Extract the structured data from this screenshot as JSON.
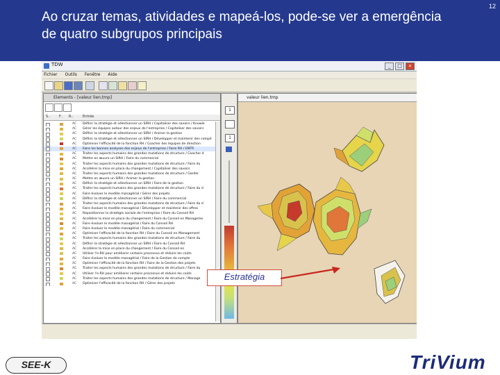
{
  "slide": {
    "title": "Ao cruzar temas, atividades e mapeá-los, pode-se ver a emergência\nde quatro subgrupos principais",
    "page_number": "12",
    "callout_label": "Estratégia",
    "logo_left": "SEE-K",
    "logo_right": "TriVium"
  },
  "app": {
    "title": "TDW",
    "menu": [
      "Fichier",
      "Outils",
      "Fenêtre",
      "Aide"
    ],
    "window_buttons": [
      "_",
      "□",
      "×"
    ]
  },
  "left_window": {
    "title": "Elements - [valeur lien.tmp]",
    "columns": [
      "S..",
      "F..",
      "R..",
      "Entrée"
    ],
    "rows": [
      {
        "color": "#d9a23a",
        "type": "AC",
        "label": "Définir la stratégie et sélectionner un SIRH / Capitaliser des savoirs / Knowle"
      },
      {
        "color": "#e0b53e",
        "type": "AC",
        "label": "Gérer les équipes autour des enjeux de l'entreprise / Capitaliser des savoirs"
      },
      {
        "color": "#e8c84a",
        "type": "AC",
        "label": "Définir la stratégie et sélectionner un SIRH / Animer la gestion"
      },
      {
        "color": "#cfd65a",
        "type": "AC",
        "label": "Définir la stratégie et sélectionner un SIRH / Développer et maintenir des compé"
      },
      {
        "color": "#c53a2b",
        "type": "AC",
        "label": "Optimiser l'efficacité de la fonction RH / Coacher des équipes de direction"
      },
      {
        "color": "#e2a236",
        "type": "AC",
        "label": "Faire les bonnes analyses des enjeux de l'entreprise / Faire RH / ENTR"
      },
      {
        "color": "#e6b73f",
        "type": "AC",
        "label": "Traiter les aspects humains des grandes mutations de structure / Coacher d"
      },
      {
        "color": "#d68b30",
        "type": "AC",
        "label": "Mettre en œuvre un SIRH / Faire du commercial"
      },
      {
        "color": "#e8c84a",
        "type": "AC",
        "label": "Traiter les aspects humains des grandes mutations de structure / Faire du"
      },
      {
        "color": "#e5a83a",
        "type": "AC",
        "label": "Accélérer la mise en place du changement / Capitaliser des savoirs"
      },
      {
        "color": "#e0bb44",
        "type": "AC",
        "label": "Traiter les aspects humains des grandes mutations de structure / Garder"
      },
      {
        "color": "#d9c24c",
        "type": "AC",
        "label": "Mettre en œuvre un SIRH / Animer la gestion"
      },
      {
        "color": "#e6b73f",
        "type": "AC",
        "label": "Définir la stratégie et sélectionner un SIRH / Faire de la gestion"
      },
      {
        "color": "#e0763a",
        "type": "AC",
        "label": "Traiter les aspects humains des grandes mutations de structure / Faire du d"
      },
      {
        "color": "#e8c84a",
        "type": "AC",
        "label": "Faire évoluer le modèle managérial / Gérer des projets"
      },
      {
        "color": "#c7d45e",
        "type": "AC",
        "label": "Définir la stratégie et sélectionner un SIRH / Faire du commercial"
      },
      {
        "color": "#d9a23a",
        "type": "AC",
        "label": "Traiter les aspects humains des grandes mutations de structure / Faire du d"
      },
      {
        "color": "#e5a83a",
        "type": "AC",
        "label": "Faire évoluer le modèle managérial / Développer et maintenir des offres"
      },
      {
        "color": "#e8c84a",
        "type": "AC",
        "label": "Repositionner la stratégie sociale de l'entreprise / Faire du Conseil RH"
      },
      {
        "color": "#e0bb44",
        "type": "AC",
        "label": "Accélérer la mise en place du changement / Faire du Conseil en Manageme"
      },
      {
        "color": "#d68b30",
        "type": "AC",
        "label": "Faire évoluer le modèle managérial / Faire du Conseil RH"
      },
      {
        "color": "#e6b73f",
        "type": "AC",
        "label": "Faire évoluer le modèle managérial / Faire du commercial"
      },
      {
        "color": "#e2a236",
        "type": "AC",
        "label": "Optimiser l'efficacité de la fonction RH / Faire du Conseil en Management"
      },
      {
        "color": "#cfd65a",
        "type": "AC",
        "label": "Traiter les aspects humains des grandes mutations de structure / Faire du"
      },
      {
        "color": "#e8c84a",
        "type": "AC",
        "label": "Définir la stratégie et sélectionner un SIRH / Faire du Conseil RH"
      },
      {
        "color": "#e0bb44",
        "type": "AC",
        "label": "Accélérer la mise en place du changement / Faire du Conseil en"
      },
      {
        "color": "#d9c24c",
        "type": "AC",
        "label": "Utiliser l'e-RH pour améliorer certains processus et réduire les coûts"
      },
      {
        "color": "#e5a83a",
        "type": "AC",
        "label": "Faire évoluer le modèle managérial / Faire de la Gestion de compte"
      },
      {
        "color": "#e6b73f",
        "type": "AC",
        "label": "Optimiser l'efficacité de la fonction RH / Faire de la Gestion des projets"
      },
      {
        "color": "#d68b30",
        "type": "AC",
        "label": "Traiter les aspects humains des grandes mutations de structure / Faire du"
      },
      {
        "color": "#e8c84a",
        "type": "AC",
        "label": "Utiliser l'e-RH pour améliorer certains processus et réduire les coûts"
      },
      {
        "color": "#cfd65a",
        "type": "AC",
        "label": "Traiter les aspects humains des grandes mutations de structure / Manage"
      },
      {
        "color": "#e2a236",
        "type": "AC",
        "label": "Optimiser l'efficacité de la fonction RH / Gérer des projets"
      }
    ]
  },
  "scale_panel": {
    "btn_top": "1",
    "btn_mid": "1"
  },
  "right_window": {
    "title": "valeur lien.tmp"
  },
  "colors": {
    "header_bg": "#24398e",
    "callout_border": "#d24b3b",
    "arrow": "#c8281e",
    "trivium": "#1c2c78"
  }
}
